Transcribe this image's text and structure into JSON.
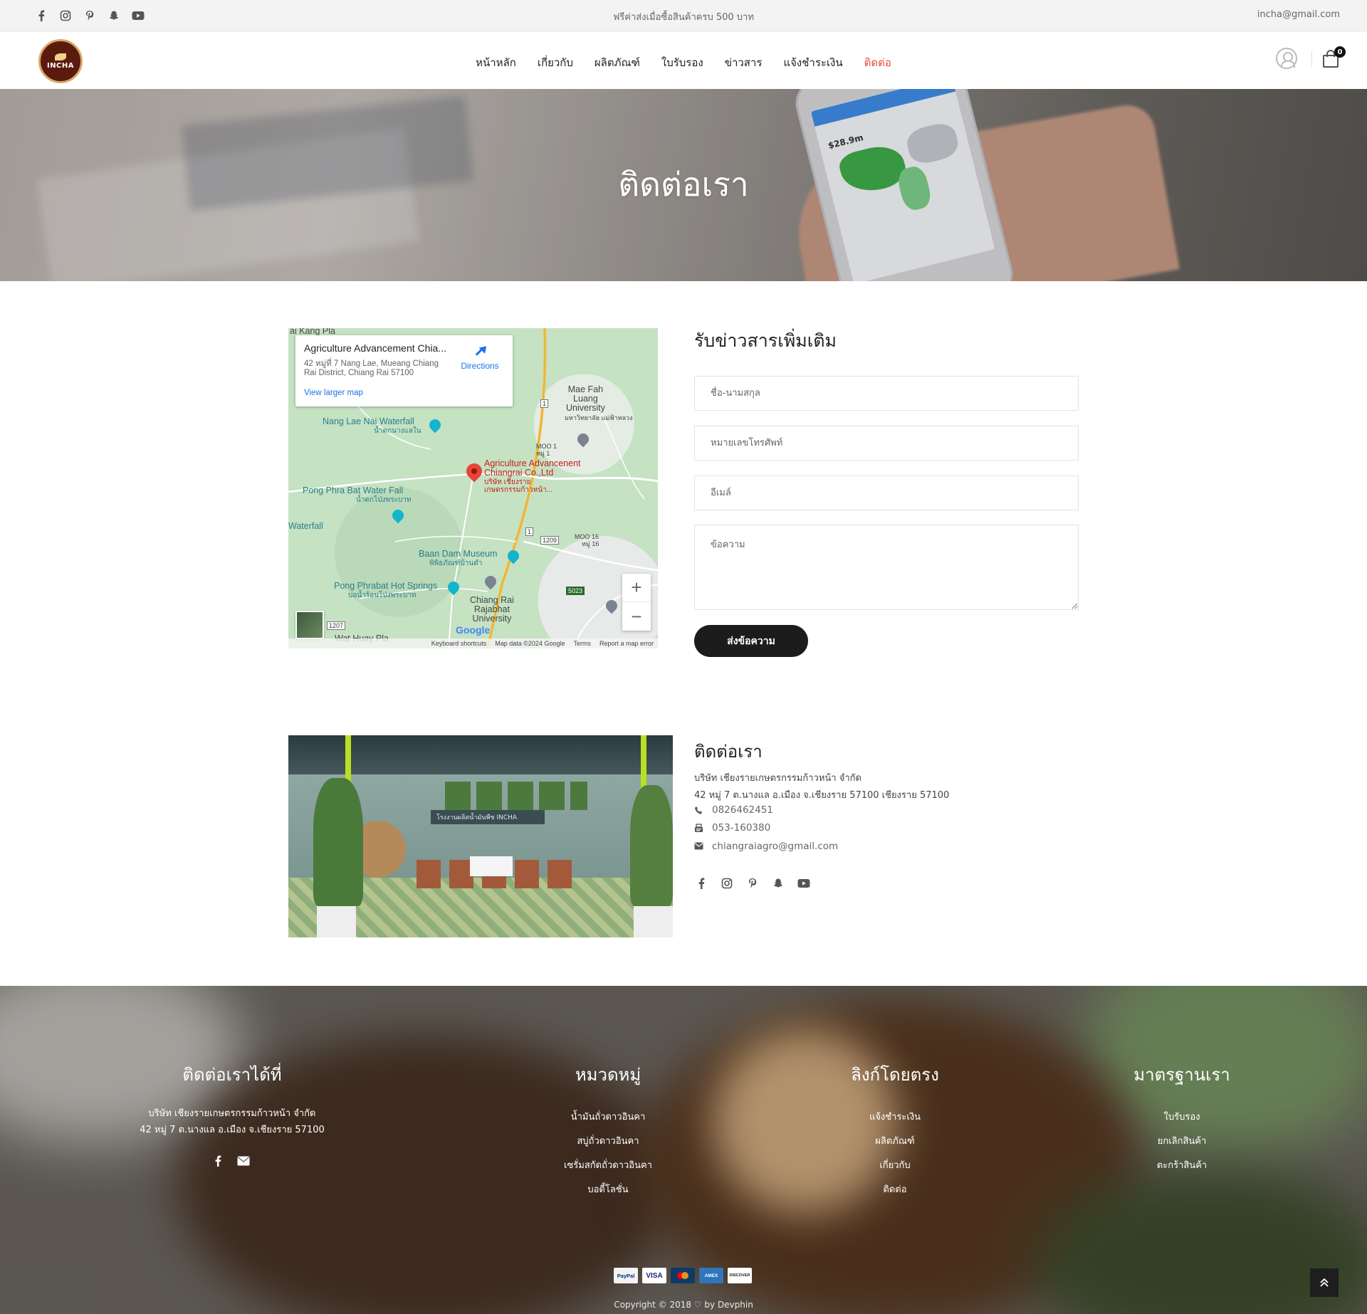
{
  "topbar": {
    "promo": "ฟรีค่าส่งเมื่อซื้อสินค้าครบ 500 บาท",
    "email": "incha@gmail.com",
    "social_icons": [
      "facebook-icon",
      "instagram-icon",
      "pinterest-icon",
      "snapchat-icon",
      "youtube-icon"
    ]
  },
  "nav": {
    "logo_text": "INCHA",
    "items": [
      {
        "label": "หน้าหลัก"
      },
      {
        "label": "เกี่ยวกับ"
      },
      {
        "label": "ผลิตภัณฑ์"
      },
      {
        "label": "ใบรับรอง"
      },
      {
        "label": "ข่าวสาร"
      },
      {
        "label": "แจ้งชำระเงิน"
      },
      {
        "label": "ติดต่อ",
        "active": true
      }
    ],
    "cart_count": "0"
  },
  "hero": {
    "title": "ติดต่อเรา",
    "phone_value": "$28.9m"
  },
  "map": {
    "place_name": "Agriculture Advancement Chia...",
    "address": "42 หมู่ที่ 7 Nang Lae, Mueang Chiang Rai District, Chiang Rai 57100",
    "larger_map": "View larger map",
    "directions": "Directions",
    "pin_label_1": "Agriculture Advancenent",
    "pin_label_2": "Chiangrai Co.,Ltd",
    "pin_label_3": "บริษัท เชียงราย",
    "pin_label_4": "เกษตรกรรมก้าวหน้า...",
    "labels": {
      "waterfall1": "Nang Lae Nai Waterfall",
      "waterfall1_th": "น้ำตกนางแลใน",
      "waterfall2": "Pong Phra Bat Water Fall",
      "waterfall2_th": "น้ำตกโป่งพระบาท",
      "waterfall3": "Waterfall",
      "university1": "Mae Fah",
      "university2": "Luang",
      "university3": "University",
      "university_th": "มหาวิทยาลัย แม่ฟ้าหลวง",
      "museum": "Baan Dam Museum",
      "museum_th": "พิพิธภัณฑ์บ้านดำ",
      "springs": "Pong Phrabat Hot Springs",
      "springs_th": "บ่อน้ำร้อนโป่งพระบาท",
      "rajabhat1": "Chiang Rai",
      "rajabhat2": "Rajabhat",
      "rajabhat3": "University",
      "huaypla": "Wat Huay Pla",
      "kangpla": "ai Kang Pla",
      "moo1": "MOO 1",
      "moo1_th": "หมู่ 1",
      "moo16": "MOO 16",
      "moo16_th": "หมู่ 16"
    },
    "shields": {
      "r1": "1",
      "r2": "1",
      "r1209": "1209",
      "r5023": "5023",
      "r1207": "1207"
    },
    "footer": {
      "shortcuts": "Keyboard shortcuts",
      "mapdata": "Map data ©2024 Google",
      "terms": "Terms",
      "report": "Report a map error"
    },
    "google": "Google"
  },
  "form": {
    "title": "รับข่าวสารเพิ่มเติม",
    "name_placeholder": "ชื่อ-นามสกุล",
    "phone_placeholder": "หมายเลขโทรศัพท์",
    "email_placeholder": "อีเมล์",
    "message_placeholder": "ข้อความ",
    "submit": "ส่งข้อความ"
  },
  "contact": {
    "title": "ติดต่อเรา",
    "company": "บริษัท เชียงรายเกษตรกรรมก้าวหน้า จำกัด",
    "address": "42 หมู่ 7 ต.นางแล อ.เมือง จ.เชียงราย 57100 เชียงราย 57100",
    "phone": "0826462451",
    "fax": "053-160380",
    "email": "chiangraiagro@gmail.com",
    "photo_sign": "โรงงานผลิตน้ำมันพืช INCHA"
  },
  "footer": {
    "col1": {
      "title": "ติดต่อเราได้ที่",
      "line1": "บริษัท เชียงรายเกษตรกรรมก้าวหน้า จำกัด",
      "line2": "42 หมู่ 7 ต.นางแล อ.เมือง จ.เชียงราย 57100"
    },
    "col2": {
      "title": "หมวดหมู่",
      "items": [
        "น้ำมันถั่วดาวอินคา",
        "สบู่ถั่วดาวอินคา",
        "เซรั่มสกัดถั่วดาวอินคา",
        "บอดี้โลชั่น"
      ]
    },
    "col3": {
      "title": "ลิงก์โดยตรง",
      "items": [
        "แจ้งชำระเงิน",
        "ผลิตภัณฑ์",
        "เกี่ยวกับ",
        "ติดต่อ"
      ]
    },
    "col4": {
      "title": "มาตรฐานเรา",
      "items": [
        "ใบรับรอง",
        "ยกเลิกสินค้า",
        "ตะกร้าสินค้า"
      ]
    },
    "payments": [
      "PayPal",
      "VISA",
      "MC",
      "AMEX",
      "DISCOVER"
    ],
    "copyright": "Copyright © 2018 ♡ by Devphin"
  },
  "colors": {
    "accent": "#e84c3d",
    "dark_button": "#1c1c1c"
  }
}
